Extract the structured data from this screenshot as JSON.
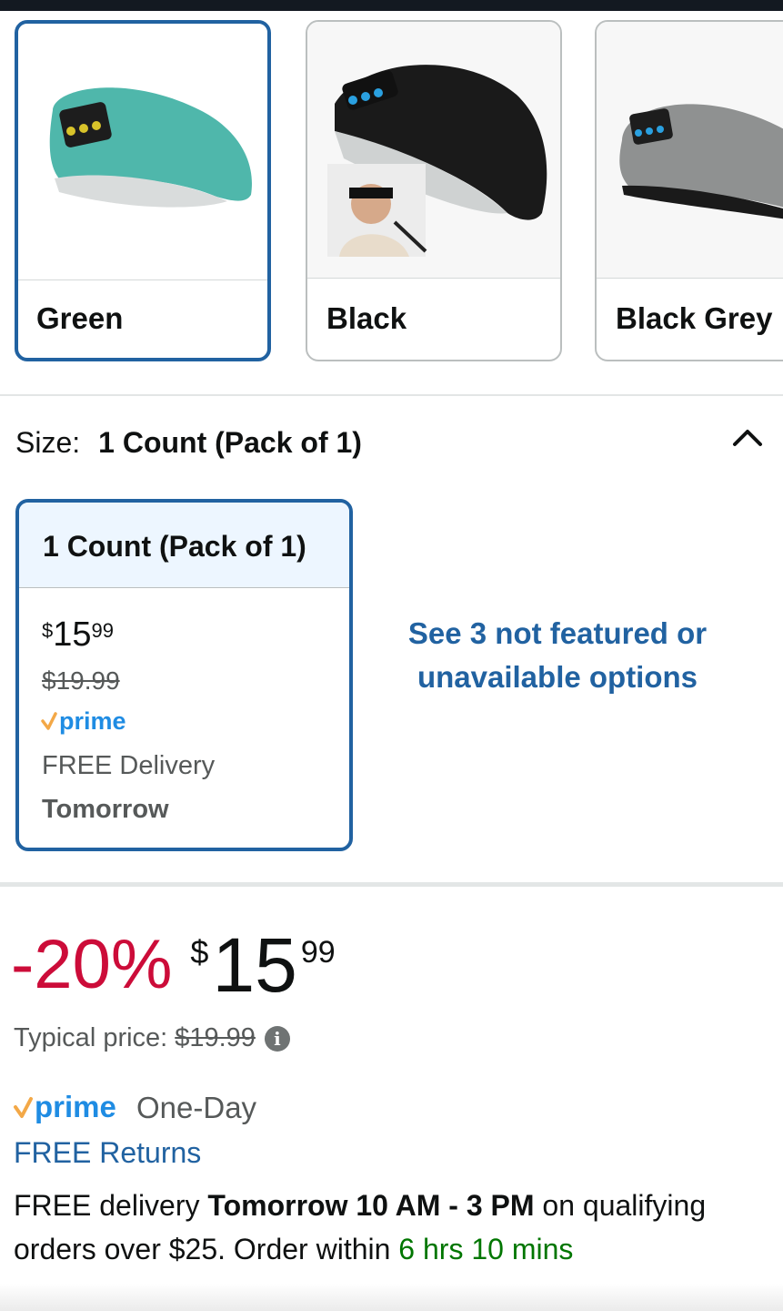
{
  "colors": {
    "selected_border": "#2162a1",
    "link": "#2162a1",
    "discount": "#cc0c39",
    "success_green": "#007600",
    "prime_blue": "#1f8ce3",
    "prime_check": "#f3a847"
  },
  "color_options": [
    {
      "label": "Green",
      "selected": true,
      "icon": "headband-green-image"
    },
    {
      "label": "Black",
      "selected": false,
      "icon": "headband-black-image"
    },
    {
      "label": "Black Grey",
      "selected": false,
      "icon": "headband-grey-image"
    }
  ],
  "size": {
    "key": "Size:",
    "value": "1 Count (Pack of 1)",
    "toggle_icon": "chevron-up-icon"
  },
  "size_card": {
    "title": "1 Count (Pack of 1)",
    "currency": "$",
    "whole": "15",
    "fraction": "99",
    "list_price": "$19.99",
    "prime_label": "prime",
    "delivery_line": "FREE Delivery",
    "delivery_day": "Tomorrow"
  },
  "see_more": "See 3 not featured or unavailable options",
  "price_block": {
    "discount": "-20%",
    "currency": "$",
    "whole": "15",
    "fraction": "99",
    "typical_label": "Typical price:",
    "typical_value": "$19.99",
    "info_icon": "info-icon"
  },
  "prime_row": {
    "prime_label": "prime",
    "suffix": "One-Day"
  },
  "returns": "FREE Returns",
  "delivery": {
    "pre": "FREE delivery",
    "window": "Tomorrow 10 AM - 3 PM",
    "mid": "on qualifying orders over $25. Order within",
    "countdown": "6 hrs 10 mins"
  }
}
